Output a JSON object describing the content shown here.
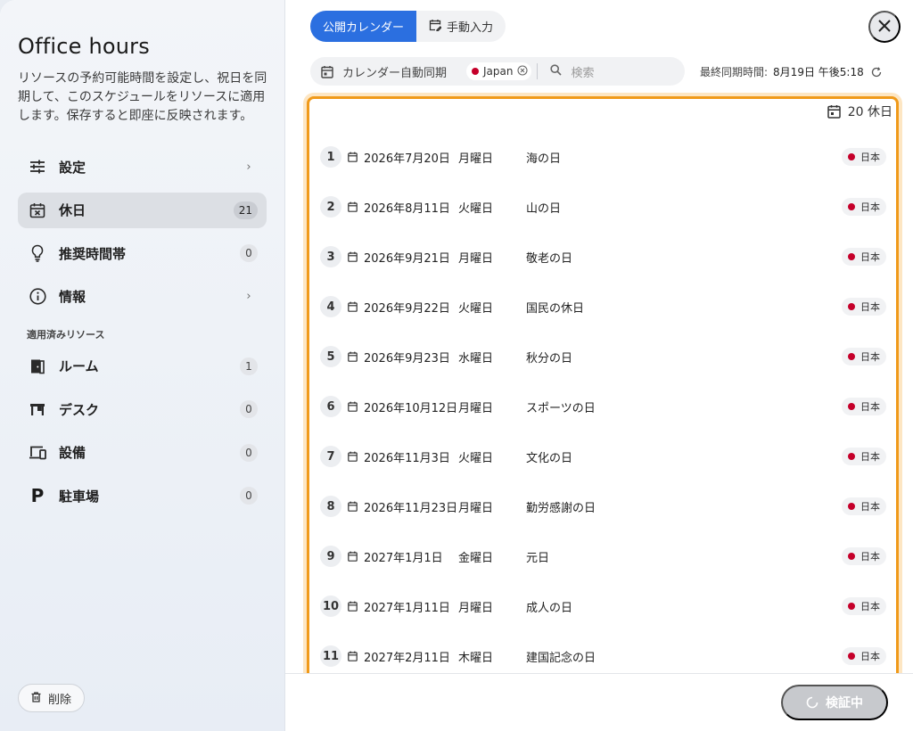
{
  "sidebar": {
    "title": "Office hours",
    "description": "リソースの予約可能時間を設定し、祝日を同期して、このスケジュールをリソースに適用します。保存すると即座に反映されます。",
    "nav": [
      {
        "label": "設定",
        "icon": "sliders-icon",
        "badge": null,
        "chevron": true
      },
      {
        "label": "休日",
        "icon": "calendar-x-icon",
        "badge": "21",
        "active": true
      },
      {
        "label": "推奨時間帯",
        "icon": "lightbulb-icon",
        "badge": "0"
      },
      {
        "label": "情報",
        "icon": "info-icon",
        "badge": null,
        "chevron": true
      }
    ],
    "section_label": "適用済みリソース",
    "resources": [
      {
        "label": "ルーム",
        "icon": "door-icon",
        "badge": "1"
      },
      {
        "label": "デスク",
        "icon": "desk-icon",
        "badge": "0"
      },
      {
        "label": "設備",
        "icon": "devices-icon",
        "badge": "0"
      },
      {
        "label": "駐車場",
        "icon": "parking-icon",
        "badge": "0"
      }
    ],
    "delete_label": "削除"
  },
  "tabs": [
    {
      "label": "公開カレンダー",
      "active": true
    },
    {
      "label": "手動入力",
      "active": false
    }
  ],
  "filter": {
    "auto_sync_label": "カレンダー自動同期",
    "chip_label": "Japan",
    "search_placeholder": "検索"
  },
  "sync": {
    "label": "最終同期時間:",
    "value": "8月19日 午後5:18"
  },
  "count_label": "20 休日",
  "holidays": [
    {
      "n": "1",
      "date": "2026年7月20日",
      "dow": "月曜日",
      "name": "海の日",
      "country": "日本"
    },
    {
      "n": "2",
      "date": "2026年8月11日",
      "dow": "火曜日",
      "name": "山の日",
      "country": "日本"
    },
    {
      "n": "3",
      "date": "2026年9月21日",
      "dow": "月曜日",
      "name": "敬老の日",
      "country": "日本"
    },
    {
      "n": "4",
      "date": "2026年9月22日",
      "dow": "火曜日",
      "name": "国民の休日",
      "country": "日本"
    },
    {
      "n": "5",
      "date": "2026年9月23日",
      "dow": "水曜日",
      "name": "秋分の日",
      "country": "日本"
    },
    {
      "n": "6",
      "date": "2026年10月12日",
      "dow": "月曜日",
      "name": "スポーツの日",
      "country": "日本"
    },
    {
      "n": "7",
      "date": "2026年11月3日",
      "dow": "火曜日",
      "name": "文化の日",
      "country": "日本"
    },
    {
      "n": "8",
      "date": "2026年11月23日",
      "dow": "月曜日",
      "name": "勤労感謝の日",
      "country": "日本"
    },
    {
      "n": "9",
      "date": "2027年1月1日",
      "dow": "金曜日",
      "name": "元日",
      "country": "日本"
    },
    {
      "n": "10",
      "date": "2027年1月11日",
      "dow": "月曜日",
      "name": "成人の日",
      "country": "日本"
    },
    {
      "n": "11",
      "date": "2027年2月11日",
      "dow": "木曜日",
      "name": "建国記念の日",
      "country": "日本"
    }
  ],
  "verify_label": "検証中",
  "colors": {
    "accent": "#2b6fe0",
    "highlight": "#f09a1a",
    "flag": "#c5002a"
  }
}
